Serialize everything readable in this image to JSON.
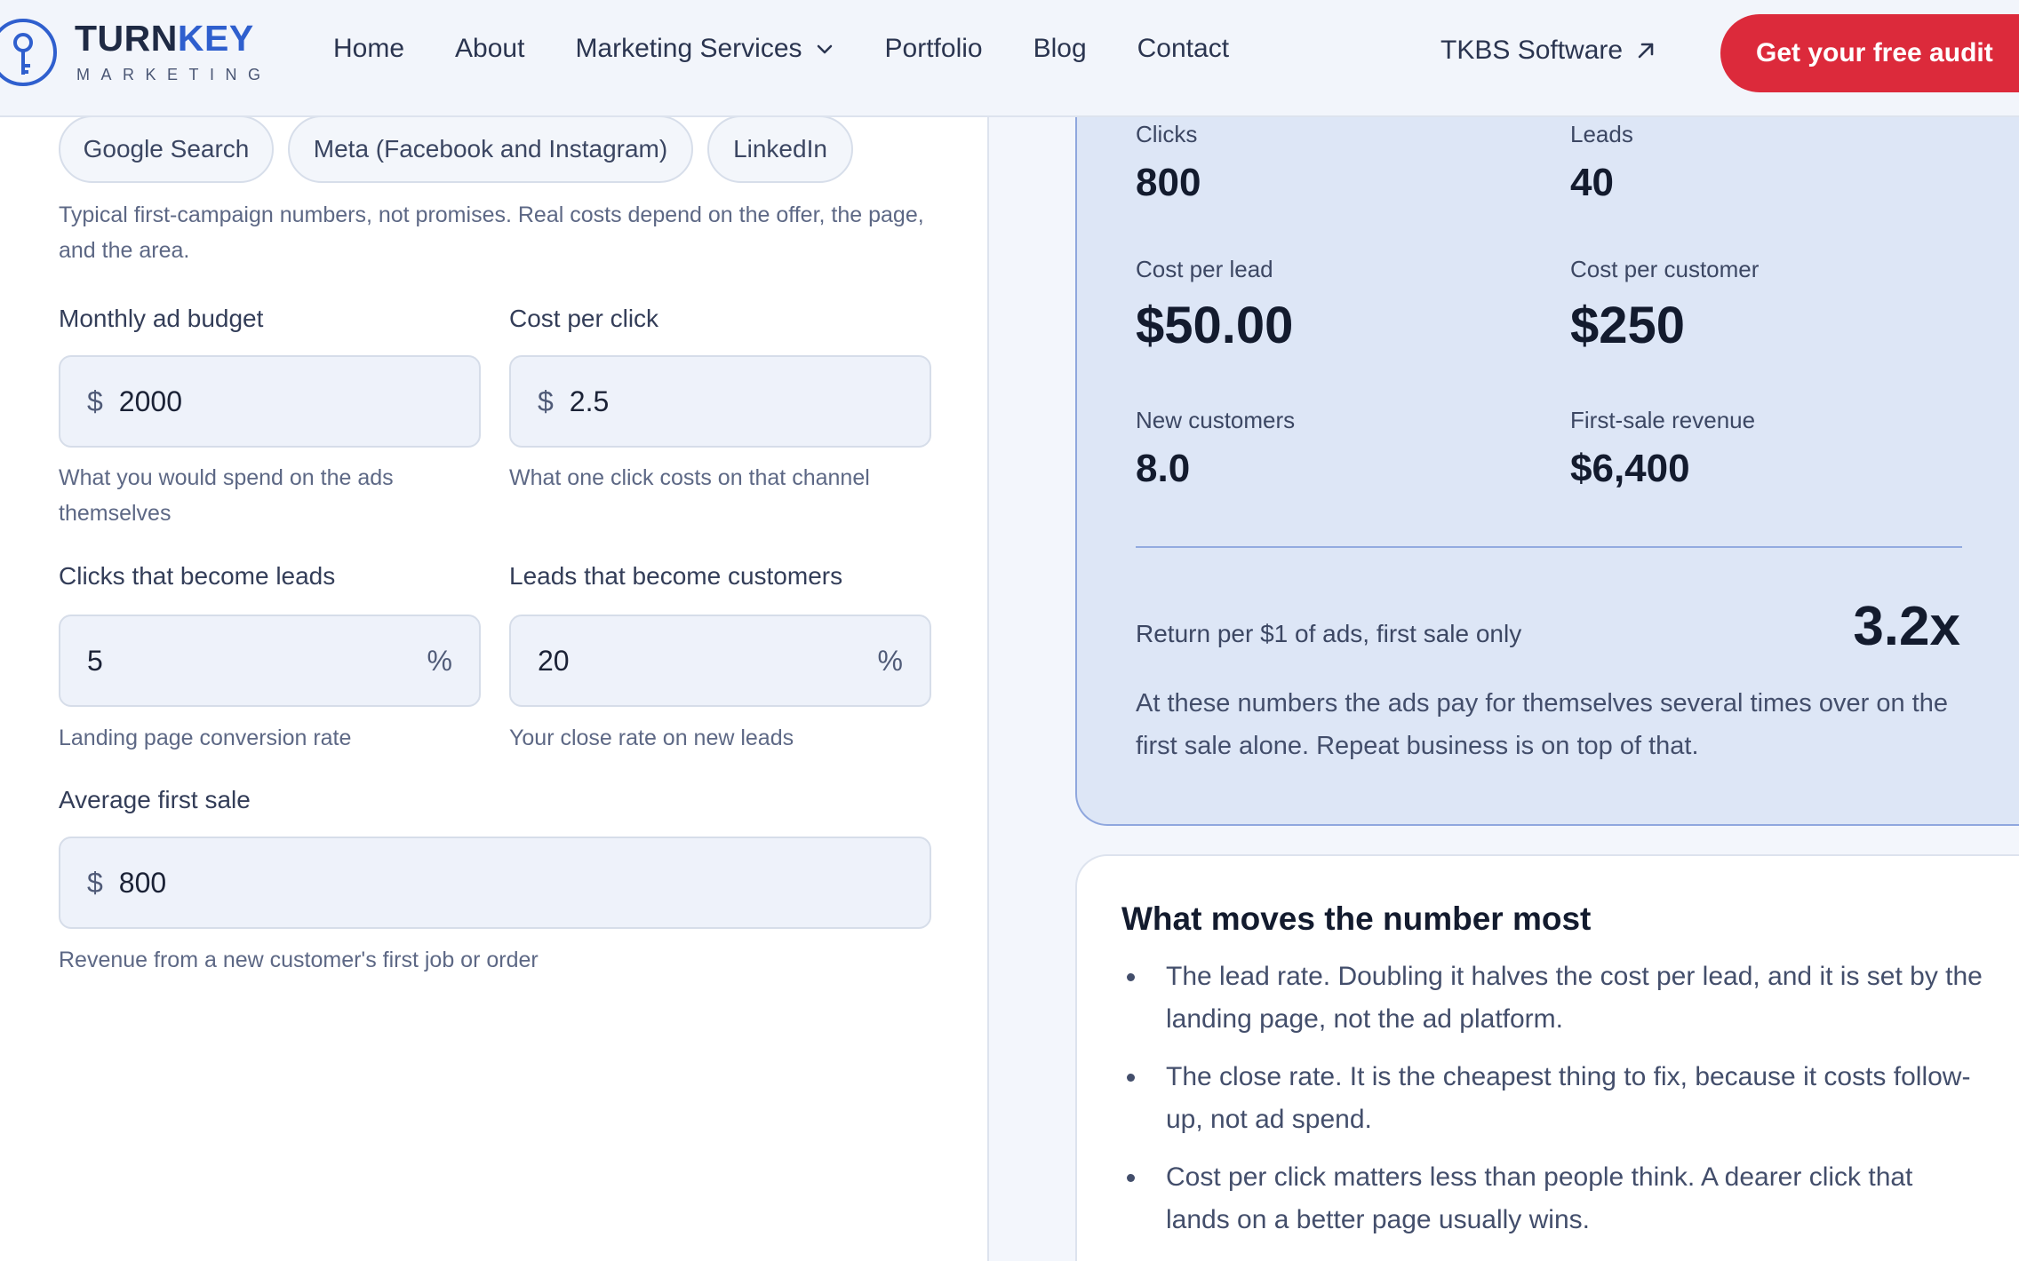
{
  "brand": {
    "name_part1": "TURN",
    "name_part2": "KEY",
    "subtitle": "MARKETING",
    "logo_icon": "key-icon",
    "accent": "#2f5fce"
  },
  "nav": {
    "items": [
      "Home",
      "About",
      "Marketing Services",
      "Portfolio",
      "Blog",
      "Contact"
    ],
    "external_link": "TKBS Software",
    "cta": "Get your free audit",
    "cta_color": "#dc2a3b"
  },
  "channels": [
    "Google Search",
    "Meta (Facebook and Instagram)",
    "LinkedIn"
  ],
  "channels_note": "Typical first-campaign numbers, not promises. Real costs depend on the offer, the page, and the area.",
  "form": {
    "budget": {
      "label": "Monthly ad budget",
      "prefix": "$",
      "value": "2000",
      "help": "What you would spend on the ads themselves"
    },
    "cpc": {
      "label": "Cost per click",
      "prefix": "$",
      "value": "2.5",
      "help": "What one click costs on that channel"
    },
    "lead_rate": {
      "label": "Clicks that become leads",
      "value": "5",
      "suffix": "%",
      "help": "Landing page conversion rate"
    },
    "close_rate": {
      "label": "Leads that become customers",
      "value": "20",
      "suffix": "%",
      "help": "Your close rate on new leads"
    },
    "avg_sale": {
      "label": "Average first sale",
      "prefix": "$",
      "value": "800",
      "help": "Revenue from a new customer's first job or order"
    }
  },
  "results": {
    "clicks": {
      "label": "Clicks",
      "value": "800"
    },
    "leads": {
      "label": "Leads",
      "value": "40"
    },
    "cost_per_lead": {
      "label": "Cost per lead",
      "value": "$50.00"
    },
    "cost_per_customer": {
      "label": "Cost per customer",
      "value": "$250"
    },
    "new_customers": {
      "label": "New customers",
      "value": "8.0"
    },
    "first_sale_revenue": {
      "label": "First-sale revenue",
      "value": "$6,400"
    },
    "roi": {
      "label": "Return per $1 of ads, first sale only",
      "value": "3.2x"
    },
    "note": "At these numbers the ads pay for themselves several times over on the first sale alone. Repeat business is on top of that."
  },
  "tips": {
    "title": "What moves the number most",
    "items": [
      "The lead rate. Doubling it halves the cost per lead, and it is set by the landing page, not the ad platform.",
      "The close rate. It is the cheapest thing to fix, because it costs follow-up, not ad spend.",
      "Cost per click matters less than people think. A dearer click that lands on a better page usually wins."
    ]
  }
}
